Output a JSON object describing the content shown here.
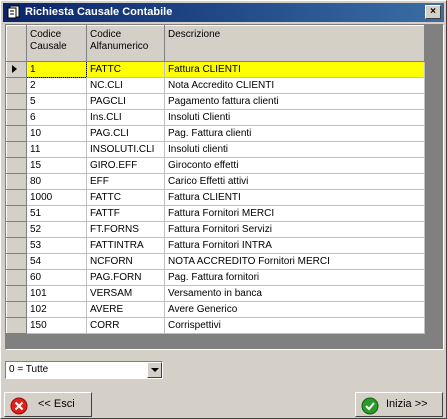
{
  "window": {
    "title": "Richiesta Causale Contabile",
    "close_glyph": "×"
  },
  "grid": {
    "columns": [
      "Codice Causale",
      "Codice Alfanumerico",
      "Descrizione"
    ],
    "column_header_lines": [
      [
        "Codice",
        "Causale"
      ],
      [
        "Codice",
        "Alfanumerico"
      ],
      [
        "Descrizione"
      ]
    ],
    "selected_row": 0,
    "rows": [
      [
        "1",
        "FATTC",
        "Fattura CLIENTI"
      ],
      [
        "2",
        "NC.CLI",
        "Nota Accredito CLIENTI"
      ],
      [
        "5",
        "PAGCLI",
        "Pagamento fattura clienti"
      ],
      [
        "6",
        "Ins.CLI",
        "Insoluti Clienti"
      ],
      [
        "10",
        "PAG.CLI",
        "Pag. Fattura clienti"
      ],
      [
        "11",
        "INSOLUTI.CLI",
        "Insoluti clienti"
      ],
      [
        "15",
        "GIRO.EFF",
        "Giroconto effetti"
      ],
      [
        "80",
        "EFF",
        "Carico Effetti attivi"
      ],
      [
        "1000",
        "FATTC",
        "Fattura CLIENTI"
      ],
      [
        "51",
        "FATTF",
        "Fattura Fornitori MERCI"
      ],
      [
        "52",
        "FT.FORNS",
        "Fattura Fornitori Servizi"
      ],
      [
        "53",
        "FATTINTRA",
        "Fattura Fornitori INTRA"
      ],
      [
        "54",
        "NCFORN",
        "NOTA ACCREDITO Fornitori MERCI"
      ],
      [
        "60",
        "PAG.FORN",
        "Pag. Fattura fornitori"
      ],
      [
        "101",
        "VERSAM",
        "Versamento in banca"
      ],
      [
        "102",
        "AVERE",
        "Avere Generico"
      ],
      [
        "150",
        "CORR",
        "Corrispettivi"
      ]
    ]
  },
  "filter": {
    "selected": "0 = Tutte"
  },
  "buttons": {
    "exit": "<< Esci",
    "start": "Inizia >>"
  },
  "colors": {
    "title_start": "#0a246a",
    "title_end": "#3a6ea5",
    "selection": "#ffff00",
    "exit_icon": "#e0201a",
    "start_icon": "#2a9a2a"
  },
  "icons": {
    "window": "form-icon",
    "exit": "red-x-icon",
    "start": "green-check-icon"
  }
}
